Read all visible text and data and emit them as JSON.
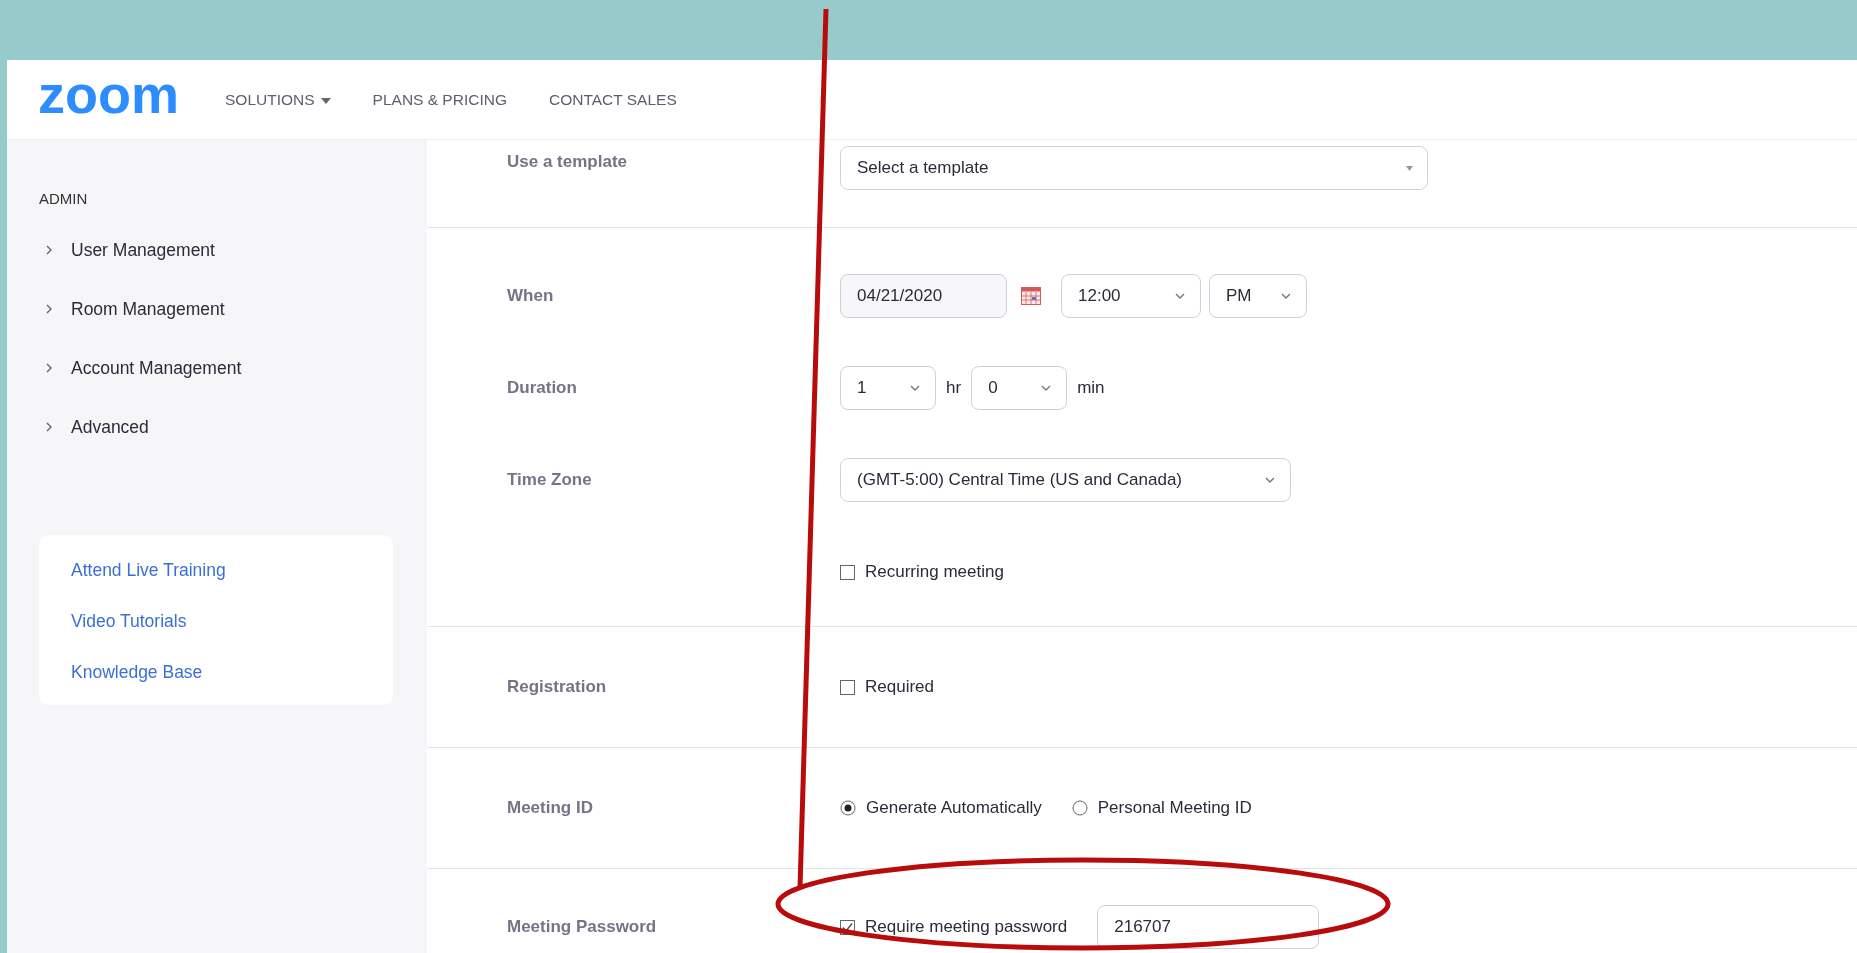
{
  "header": {
    "logo": "zoom",
    "nav": [
      {
        "label": "SOLUTIONS",
        "dropdown": true
      },
      {
        "label": "PLANS & PRICING",
        "dropdown": false
      },
      {
        "label": "CONTACT SALES",
        "dropdown": false
      }
    ]
  },
  "sidebar": {
    "heading": "ADMIN",
    "items": [
      {
        "label": "User Management",
        "expanded": false
      },
      {
        "label": "Room Management",
        "expanded": false
      },
      {
        "label": "Account Management",
        "expanded": false
      },
      {
        "label": "Advanced",
        "expanded": false
      }
    ],
    "links": [
      "Attend Live Training",
      "Video Tutorials",
      "Knowledge Base"
    ]
  },
  "form": {
    "sections": [
      {
        "rows": [
          {
            "label": "Use a template",
            "controls": [
              {
                "kind": "dropdown",
                "value": "Select a template"
              }
            ]
          }
        ]
      },
      {
        "rows": [
          {
            "label": "When",
            "controls": [
              {
                "kind": "date",
                "value": "04/21/2020"
              },
              {
                "kind": "select",
                "value": "12:00"
              },
              {
                "kind": "select",
                "value": "PM"
              }
            ]
          },
          {
            "label": "Duration",
            "controls": [
              {
                "kind": "select",
                "value": "1"
              },
              {
                "kind": "text",
                "value": "hr"
              },
              {
                "kind": "select",
                "value": "0"
              },
              {
                "kind": "text",
                "value": "min"
              }
            ]
          },
          {
            "label": "Time Zone",
            "controls": [
              {
                "kind": "select",
                "value": "(GMT-5:00) Central Time (US and Canada)"
              }
            ]
          },
          {
            "controls": [
              {
                "kind": "checkbox",
                "label": "Recurring meeting",
                "checked": false
              }
            ]
          }
        ]
      },
      {
        "rows": [
          {
            "label": "Registration",
            "controls": [
              {
                "kind": "checkbox",
                "label": "Required",
                "checked": false
              }
            ]
          }
        ]
      },
      {
        "rows": [
          {
            "label": "Meeting ID",
            "controls": [
              {
                "kind": "radio",
                "label": "Generate Automatically",
                "selected": true
              },
              {
                "kind": "radio",
                "label": "Personal Meeting ID",
                "selected": false
              }
            ]
          }
        ]
      },
      {
        "rows": [
          {
            "label": "Meeting Password",
            "controls": [
              {
                "kind": "checkbox",
                "label": "Require meeting password",
                "checked": true
              },
              {
                "kind": "input",
                "value": "216707"
              }
            ]
          }
        ]
      }
    ]
  }
}
